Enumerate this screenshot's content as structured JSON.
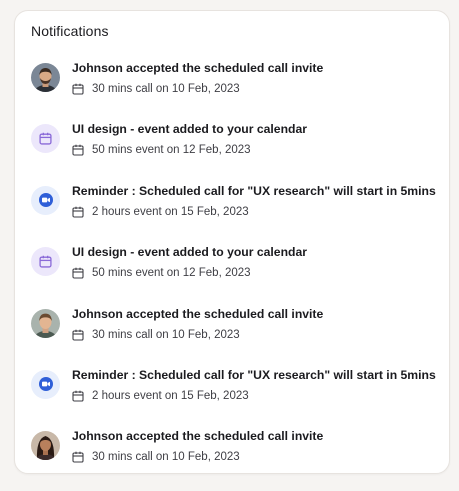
{
  "panel": {
    "title": "Notifications"
  },
  "notifications": [
    {
      "kind": "avatar",
      "icon": "avatar-man-beard-icon",
      "title": "Johnson accepted the scheduled call invite",
      "meta_icon": "calendar-icon",
      "meta": "30 mins call on 10 Feb, 2023"
    },
    {
      "kind": "calendar",
      "icon": "calendar-badge-icon",
      "title": "UI design - event added to your calendar",
      "meta_icon": "calendar-icon",
      "meta": "50 mins event on 12 Feb, 2023"
    },
    {
      "kind": "reminder",
      "icon": "video-call-icon",
      "title": "Reminder : Scheduled call for \"UX research\" will start in 5mins",
      "meta_icon": "calendar-icon",
      "meta": "2 hours event on 15 Feb, 2023"
    },
    {
      "kind": "calendar",
      "icon": "calendar-badge-icon",
      "title": "UI design - event added to your calendar",
      "meta_icon": "calendar-icon",
      "meta": "50 mins event on 12 Feb, 2023"
    },
    {
      "kind": "avatar",
      "icon": "avatar-man-icon",
      "title": "Johnson accepted the scheduled call invite",
      "meta_icon": "calendar-icon",
      "meta": "30 mins call on 10 Feb, 2023"
    },
    {
      "kind": "reminder",
      "icon": "video-call-icon",
      "title": "Reminder : Scheduled call for \"UX research\" will start in 5mins",
      "meta_icon": "calendar-icon",
      "meta": "2 hours event on 15 Feb, 2023"
    },
    {
      "kind": "avatar",
      "icon": "avatar-woman-icon",
      "title": "Johnson accepted the scheduled call invite",
      "meta_icon": "calendar-icon",
      "meta": "30 mins call on 10 Feb, 2023"
    }
  ],
  "colors": {
    "calendar_badge_bg": "#ece7fb",
    "calendar_badge_fg": "#8a6ad8",
    "reminder_badge_bg": "#e7eefc",
    "reminder_badge_fg": "#2f5fd8"
  }
}
